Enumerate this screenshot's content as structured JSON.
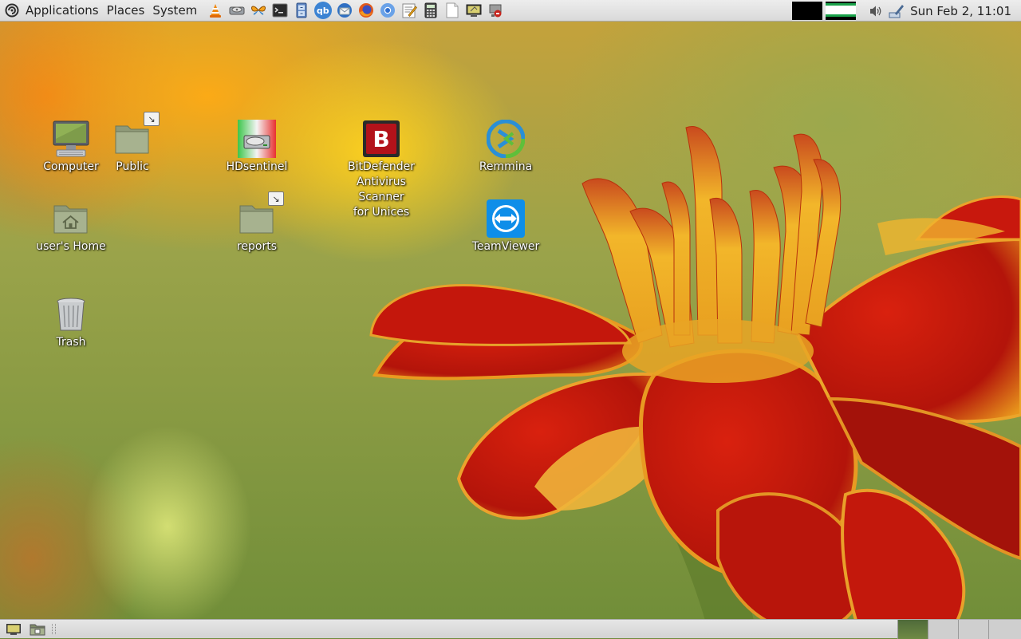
{
  "top_panel": {
    "menus": {
      "applications": "Applications",
      "places": "Places",
      "system": "System"
    },
    "launchers": [
      {
        "name": "vlc-icon",
        "glyph": ""
      },
      {
        "name": "disk-utility-icon",
        "glyph": ""
      },
      {
        "name": "butterfly-app-icon",
        "glyph": ""
      },
      {
        "name": "terminal-icon",
        "glyph": ""
      },
      {
        "name": "file-cabinet-icon",
        "glyph": ""
      },
      {
        "name": "qbittorrent-icon",
        "glyph": "qb"
      },
      {
        "name": "thunderbird-icon",
        "glyph": ""
      },
      {
        "name": "firefox-icon",
        "glyph": ""
      },
      {
        "name": "chromium-icon",
        "glyph": ""
      },
      {
        "name": "text-editor-icon",
        "glyph": ""
      },
      {
        "name": "calculator-icon",
        "glyph": ""
      },
      {
        "name": "blank-document-icon",
        "glyph": ""
      },
      {
        "name": "remote-desktop-icon",
        "glyph": ""
      },
      {
        "name": "network-tool-icon",
        "glyph": ""
      }
    ],
    "clock": "Sun Feb  2, 11:01"
  },
  "desktop": {
    "icons": [
      {
        "id": "computer",
        "label": "Computer"
      },
      {
        "id": "public",
        "label": "Public"
      },
      {
        "id": "hdsentinel",
        "label": "HDsentinel"
      },
      {
        "id": "bitdefender",
        "label": "BitDefender\nAntivirus Scanner\nfor Unices"
      },
      {
        "id": "remmina",
        "label": "Remmina"
      },
      {
        "id": "home",
        "label": "user's Home"
      },
      {
        "id": "reports",
        "label": "reports"
      },
      {
        "id": "teamviewer",
        "label": "TeamViewer"
      },
      {
        "id": "trash",
        "label": "Trash"
      }
    ],
    "bitdefender_glyph": "B",
    "emblem_glyph": "↘"
  },
  "colors": {
    "panel_bg": "#e2e2e2",
    "teamviewer_blue": "#0e8ee9",
    "bitdefender_red": "#b3121a",
    "remmina_blue": "#2a8fd6",
    "remmina_green": "#5fbf3a",
    "folder_green": "#a3ad8c",
    "cpu_monitor_green": "#1aa24a"
  }
}
